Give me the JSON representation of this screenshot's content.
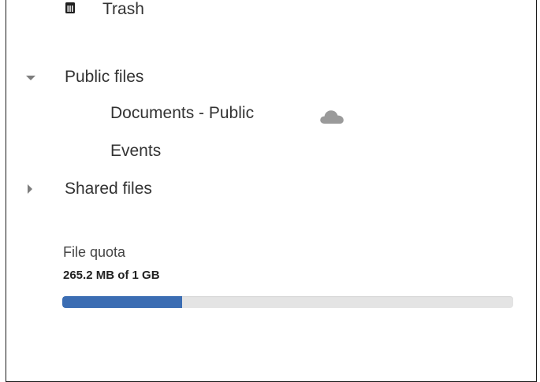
{
  "colors": {
    "text": "#333333",
    "caret": "#7d7d7d",
    "cloud_icon": "#999999",
    "quota_fill": "#3b6db3",
    "quota_track": "#e4e4e4"
  },
  "nav": {
    "trash": {
      "label": "Trash",
      "icon": "trash-icon"
    },
    "public_files": {
      "label": "Public files",
      "expanded": true,
      "children": [
        {
          "label": "Documents - Public",
          "icon": "cloud-icon"
        },
        {
          "label": "Events"
        }
      ]
    },
    "shared_files": {
      "label": "Shared files",
      "expanded": false
    }
  },
  "quota": {
    "title": "File quota",
    "usage_text": "265.2 MB of 1 GB",
    "used_fraction": 0.2652
  }
}
